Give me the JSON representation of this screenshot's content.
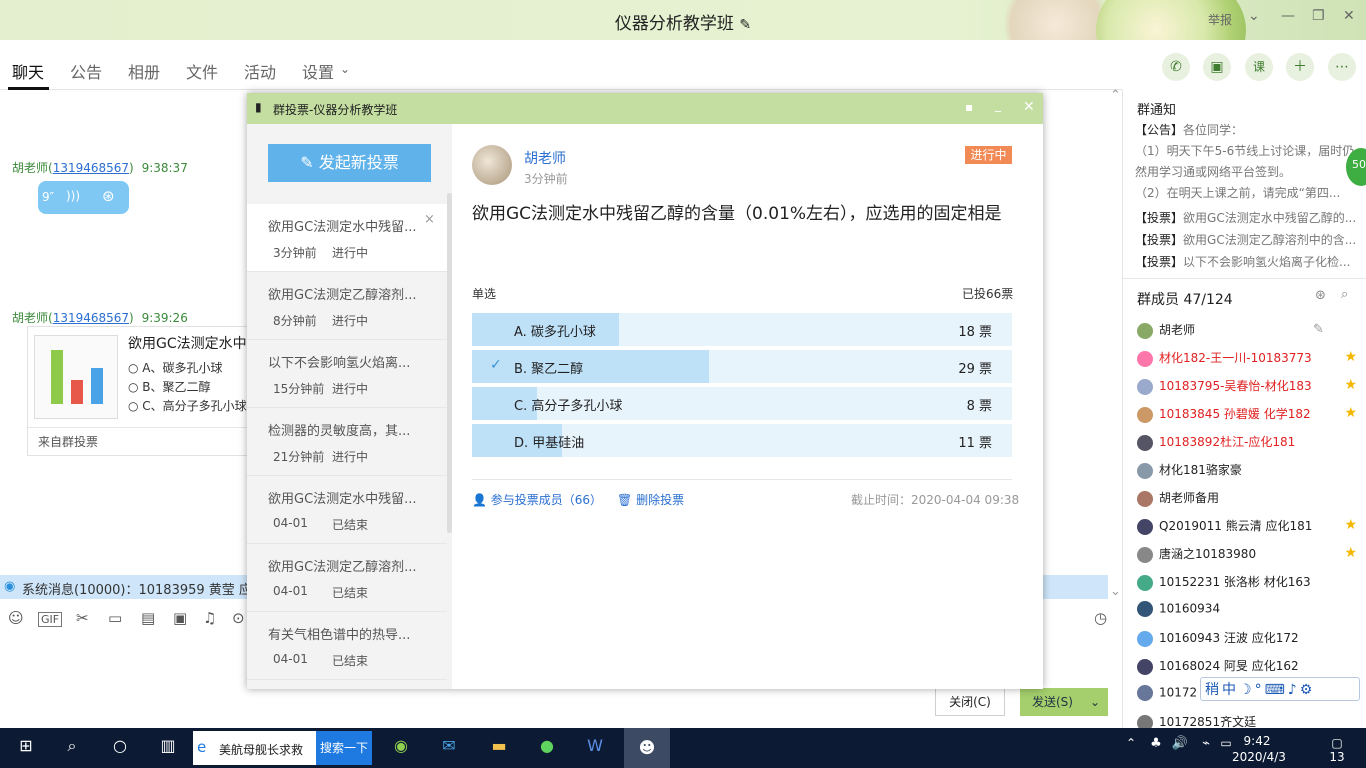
{
  "window": {
    "title": "仪器分析教学班",
    "report": "举报"
  },
  "tabs": [
    "聊天",
    "公告",
    "相册",
    "文件",
    "活动",
    "设置"
  ],
  "chat": {
    "msg1": {
      "sender": "胡老师(",
      "qq": "1319468567",
      "close": ")",
      "time": "9:38:37",
      "voice": "9″"
    },
    "msg2": {
      "sender": "胡老师(",
      "qq": "1319468567",
      "close": ")",
      "time": "9:39:26"
    },
    "card": {
      "title": "欲用GC法测定水中",
      "options": [
        "A、碳多孔小球",
        "B、聚乙二醇",
        "C、高分子多孔小球"
      ],
      "footer": "来自群投票"
    },
    "system": "系统消息(10000)：10183959 黄莹 应化1",
    "close_btn": "关闭(C)",
    "send_btn": "发送(S)"
  },
  "notice": {
    "heading": "群通知",
    "lines": [
      {
        "tag": "【公告】",
        "text": "各位同学："
      },
      {
        "tag": "",
        "text": "（1）明天下午5-6节线上讨论课，届时仍"
      },
      {
        "tag": "",
        "text": "然用学习通或网络平台签到。"
      },
      {
        "tag": "",
        "text": "（2）在明天上课之前，请完成“第四..."
      },
      {
        "tag": "【投票】",
        "text": "欲用GC法测定水中残留乙醇的..."
      },
      {
        "tag": "【投票】",
        "text": "欲用GC法测定乙醇溶剂中的含..."
      },
      {
        "tag": "【投票】",
        "text": "以下不会影响氢火焰离子化检..."
      }
    ]
  },
  "members": {
    "heading": "群成员 47/124",
    "list": [
      {
        "name": "胡老师",
        "red": false,
        "star": false
      },
      {
        "name": "材化182-王一川-10183773",
        "red": true,
        "star": true
      },
      {
        "name": "10183795-吴春怡-材化183",
        "red": true,
        "star": true
      },
      {
        "name": "10183845 孙碧媛 化学182",
        "red": true,
        "star": true
      },
      {
        "name": "10183892杜江-应化181",
        "red": true,
        "star": false
      },
      {
        "name": "材化181骆家豪",
        "red": false,
        "star": false
      },
      {
        "name": "胡老师备用",
        "red": false,
        "star": false
      },
      {
        "name": "Q2019011 熊云清 应化181",
        "red": false,
        "star": true
      },
      {
        "name": "唐涵之10183980",
        "red": false,
        "star": true
      },
      {
        "name": "10152231 张洛彬 材化163",
        "red": false,
        "star": false
      },
      {
        "name": "10160934",
        "red": false,
        "star": false
      },
      {
        "name": "10160943 汪波 应化172",
        "red": false,
        "star": false
      },
      {
        "name": "10168024 阿旻 应化162",
        "red": false,
        "star": false
      },
      {
        "name": "10172",
        "red": false,
        "star": false
      },
      {
        "name": "10172851齐文廷",
        "red": false,
        "star": false
      }
    ]
  },
  "poll": {
    "title": "群投票-仪器分析教学班",
    "new_vote": "发起新投票",
    "list": [
      {
        "title": "欲用GC法测定水中残留...",
        "meta": "3分钟前",
        "status": "进行中"
      },
      {
        "title": "欲用GC法测定乙醇溶剂...",
        "meta": "8分钟前",
        "status": "进行中"
      },
      {
        "title": "以下不会影响氢火焰离...",
        "meta": "15分钟前",
        "status": "进行中"
      },
      {
        "title": "检测器的灵敏度高，其...",
        "meta": "21分钟前",
        "status": "进行中"
      },
      {
        "title": "欲用GC法测定水中残留...",
        "meta": "04-01",
        "status": "已结束"
      },
      {
        "title": "欲用GC法测定乙醇溶剂...",
        "meta": "04-01",
        "status": "已结束"
      },
      {
        "title": "有关气相色谱中的热导...",
        "meta": "04-01",
        "status": "已结束"
      }
    ],
    "author": "胡老师",
    "time": "3分钟前",
    "status": "进行中",
    "question": "欲用GC法测定水中残留乙醇的含量（0.01%左右），应选用的固定相是",
    "type": "单选",
    "total": "已投66票",
    "options": [
      {
        "label": "A.  碳多孔小球",
        "votes": 18,
        "count": "18 票",
        "selected": false
      },
      {
        "label": "B.  聚乙二醇",
        "votes": 29,
        "count": "29 票",
        "selected": true
      },
      {
        "label": "C.  高分子多孔小球",
        "votes": 8,
        "count": "8 票",
        "selected": false
      },
      {
        "label": "D.  甲基硅油",
        "votes": 11,
        "count": "11 票",
        "selected": false
      }
    ],
    "participants": "参与投票成员（66）",
    "delete": "删除投票",
    "deadline": "截止时间：2020-04-04 09:38"
  },
  "taskbar": {
    "search_text": "美航母舰长求救",
    "search_btn": "搜索一下",
    "time": "9:42",
    "date": "2020/4/3",
    "notif": "13"
  }
}
